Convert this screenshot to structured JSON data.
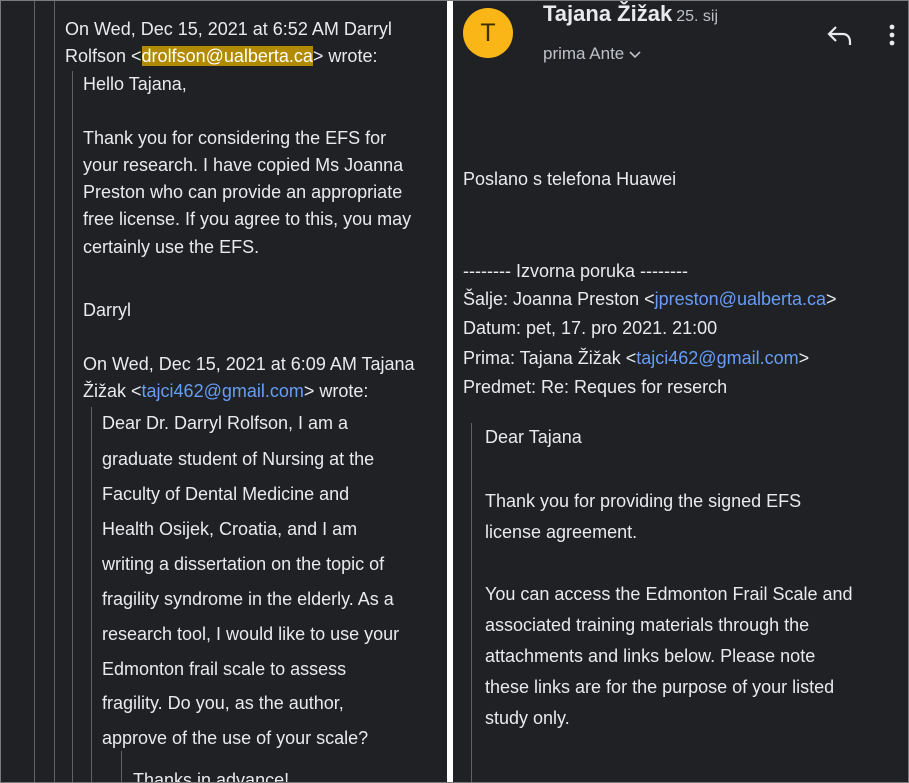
{
  "left_panel": {
    "header_lines": [
      "On Wed, Dec 15, 2021 at 6:52 AM Darryl"
    ],
    "header_line2_prefix": "Rolfson <",
    "header_email": "drolfson@ualberta.ca",
    "header_line2_suffix": "> wrote:",
    "reply_lines": [
      "Hello Tajana,",
      "Thank you for considering the EFS for",
      "your research.  I have copied Ms Joanna",
      "Preston who can provide an appropriate",
      "free license.  If you agree to this, you may",
      "certainly use the EFS.",
      "Darryl"
    ],
    "nested_header_line1": "On Wed, Dec 15, 2021 at 6:09 AM Tajana",
    "nested_header_line2_prefix": "Žižak <",
    "nested_header_email": "tajci462@gmail.com",
    "nested_header_line2_suffix": "> wrote:",
    "nested_lines": [
      "Dear Dr. Darryl Rolfson, I am a",
      "graduate student of Nursing at the",
      "Faculty of Dental Medicine and",
      "Health Osijek, Croatia, and I am",
      "writing a dissertation on the topic of",
      "fragility syndrome in the elderly. As a",
      "research tool, I would like to use your",
      "Edmonton frail scale to assess",
      "fragility. Do you, as the author,",
      "approve of the use of your scale?",
      "Thanks in advance!"
    ]
  },
  "right_panel": {
    "avatar_letter": "T",
    "avatar_color": "#f9b616",
    "sender_name": "Tajana Žižak",
    "sender_date": "25. sij",
    "to_line": "prima Ante",
    "icons": [
      "reply-icon",
      "more-vert-icon",
      "chevron-down-icon"
    ],
    "signature": "Poslano s telefona Huawei",
    "forward_header": "-------- Izvorna poruka --------",
    "from_prefix": "Šalje: Joanna Preston <",
    "from_email": "jpreston@ualberta.ca",
    "from_suffix": ">",
    "date_line": "Datum: pet, 17. pro 2021. 21:00",
    "to_prefix": "Prima: Tajana Žižak <",
    "to_email": "tajci462@gmail.com",
    "to_suffix": ">",
    "subject_line": "Predmet: Re: Reques for reserch",
    "quoted_lines": [
      "Dear Tajana",
      "Thank you for providing the signed EFS",
      "license agreement.",
      "You can access the Edmonton Frail Scale and",
      "associated training materials through the",
      "attachments and links below.  Please note",
      "these links are for the purpose of your listed",
      "study only."
    ]
  },
  "colors": {
    "background": "#202124",
    "text": "#e8eaed",
    "link": "#669df6",
    "highlight": "#b28a00",
    "quote_bar": "#5f6368"
  }
}
